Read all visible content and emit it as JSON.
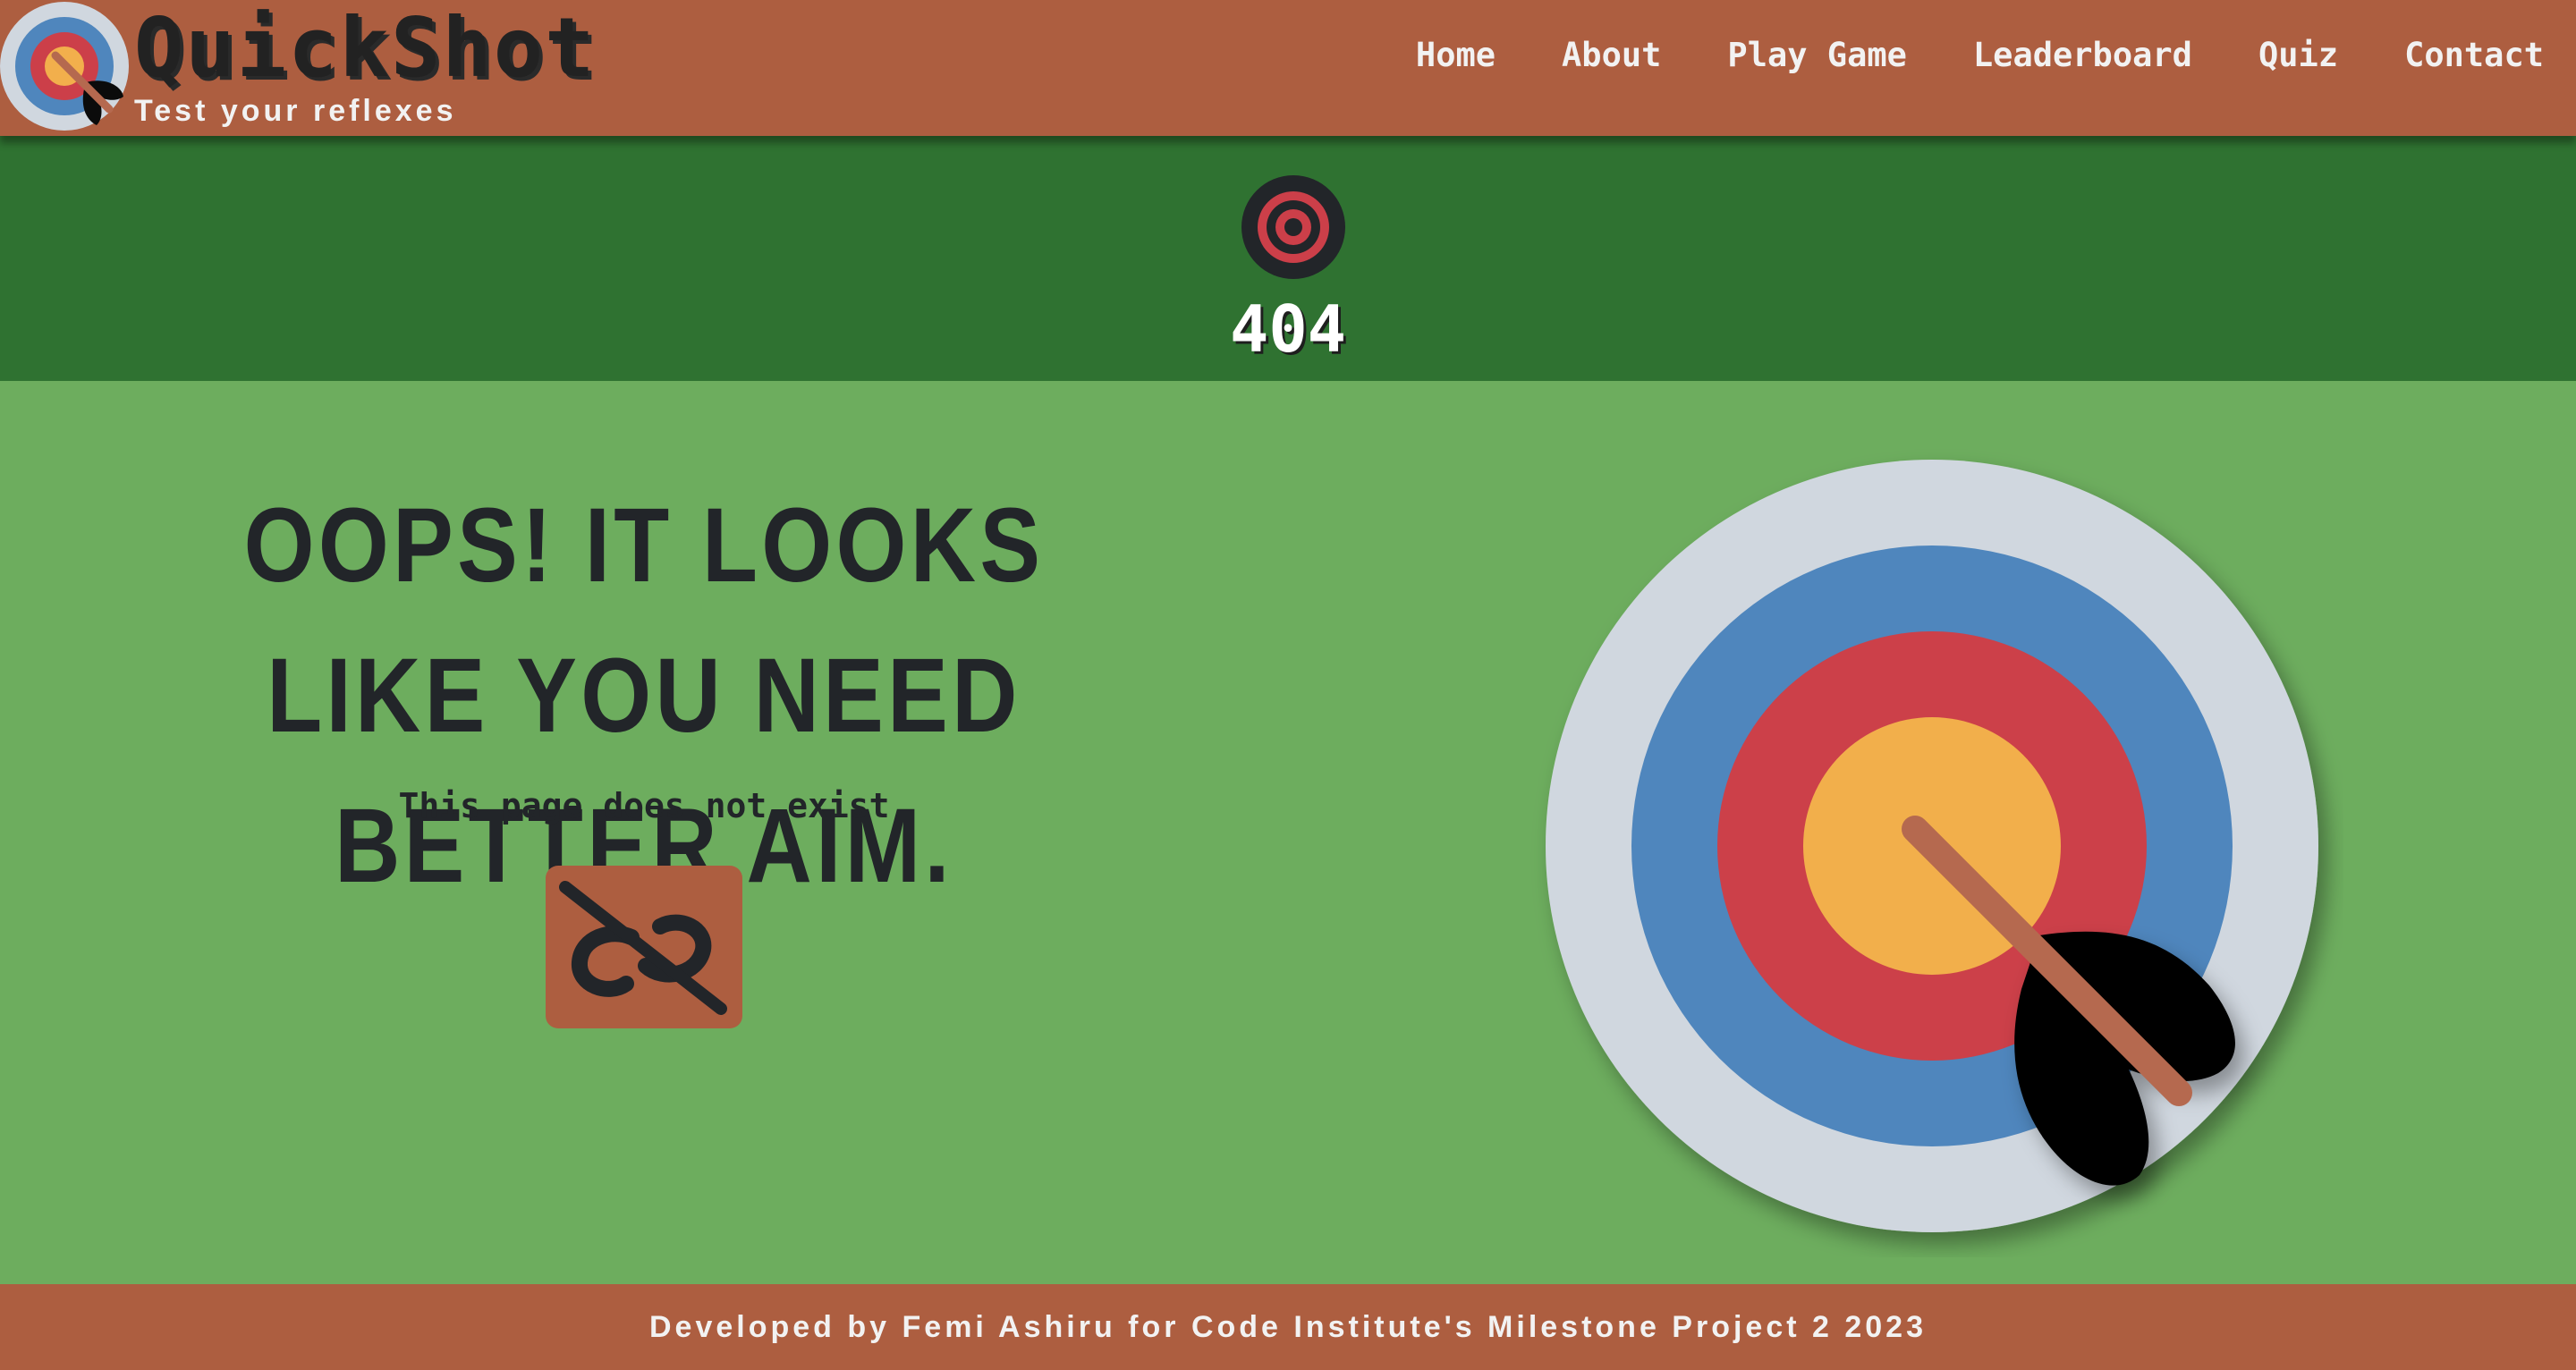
{
  "header": {
    "logo_icon": "target-arrow-icon",
    "brand_name": "QuickShot",
    "tagline": "Test your reflexes"
  },
  "nav": {
    "items": [
      {
        "label": "Home"
      },
      {
        "label": "About"
      },
      {
        "label": "Play Game"
      },
      {
        "label": "Leaderboard"
      },
      {
        "label": "Quiz"
      },
      {
        "label": "Contact"
      }
    ]
  },
  "hero": {
    "icon": "bullseye-icon",
    "code": "404"
  },
  "main": {
    "headline": "OOPS! IT LOOKS LIKE YOU NEED BETTER AIM.",
    "subtext": "This page does not exist",
    "link_icon": "broken-link-icon",
    "illustration": "archery-target-arrow-icon"
  },
  "footer": {
    "text": "Developed by Femi Ashiru for Code Institute's Milestone Project 2 2023"
  },
  "colors": {
    "header_bg": "#ad5e40",
    "hero_bg": "#2f7231",
    "main_bg": "#6dad5e",
    "text_dark": "#222529",
    "target_outer": "#d0d7df",
    "target_blue": "#4f86bd",
    "target_red": "#cc3f49",
    "target_center": "#f2af4c"
  }
}
